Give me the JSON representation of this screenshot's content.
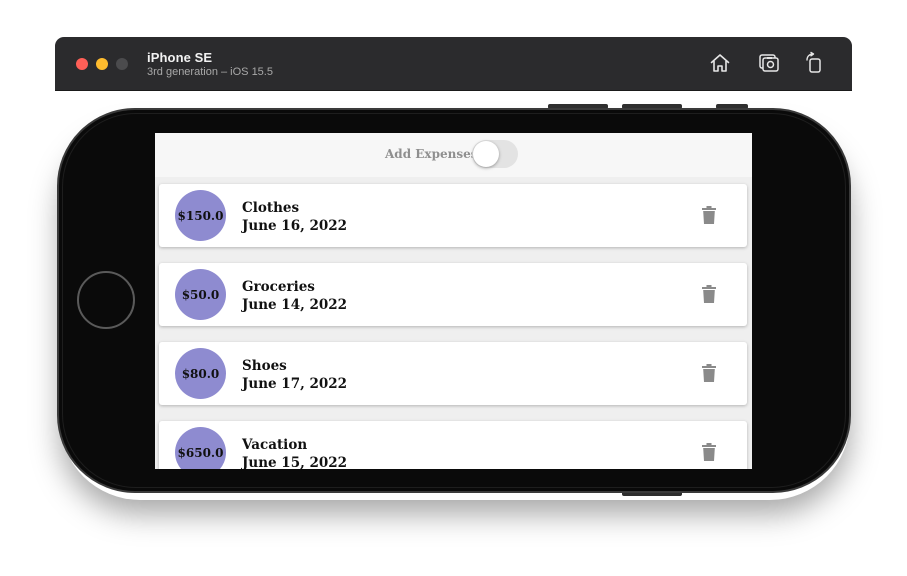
{
  "simulator": {
    "device_name": "iPhone SE",
    "device_subtitle": "3rd generation – iOS 15.5",
    "toolbar": [
      {
        "icon": "home-icon",
        "label": "Home"
      },
      {
        "icon": "screenshot-icon",
        "label": "Screenshot"
      },
      {
        "icon": "rotate-icon",
        "label": "Rotate"
      }
    ]
  },
  "app": {
    "header": {
      "label": "Add Expenses",
      "toggle_on": false
    },
    "expenses": [
      {
        "amount": "$150.0",
        "title": "Clothes",
        "date": "June 16, 2022"
      },
      {
        "amount": "$50.0",
        "title": "Groceries",
        "date": "June 14, 2022"
      },
      {
        "amount": "$80.0",
        "title": "Shoes",
        "date": "June 17, 2022"
      },
      {
        "amount": "$650.0",
        "title": "Vacation",
        "date": "June 15, 2022"
      }
    ]
  },
  "colors": {
    "avatar": "#8e8bd0",
    "trash": "#8a8a8a",
    "close": "#fe5f57",
    "minimize": "#febc2e"
  }
}
